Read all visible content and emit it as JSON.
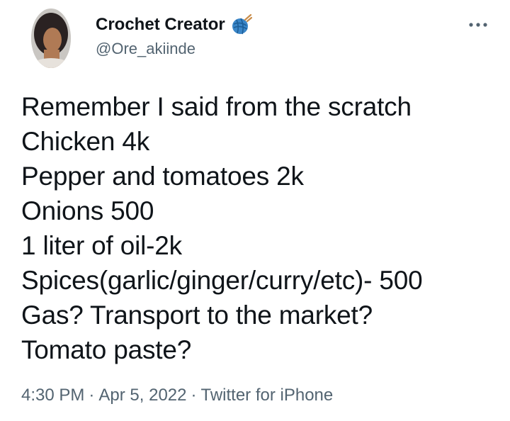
{
  "user": {
    "display_name": "Crochet Creator",
    "handle": "@Ore_akiinde",
    "name_emoji_icon": "yarn-ball-emoji-icon",
    "avatar_icon": "profile-photo"
  },
  "menu": {
    "more_icon": "more-dots-icon"
  },
  "tweet": {
    "lines": [
      "Remember I said from the scratch",
      "Chicken 4k",
      "Pepper and tomatoes 2k",
      "Onions 500",
      "1 liter of oil-2k",
      "Spices(garlic/ginger/curry/etc)- 500",
      "Gas? Transport to the market?",
      "Tomato paste?"
    ]
  },
  "meta": {
    "time": "4:30 PM",
    "separator": "·",
    "date": "Apr 5, 2022",
    "source": "Twitter for iPhone"
  },
  "colors": {
    "text": "#0f1419",
    "secondary": "#536471",
    "yarn": "#3a86c8"
  }
}
